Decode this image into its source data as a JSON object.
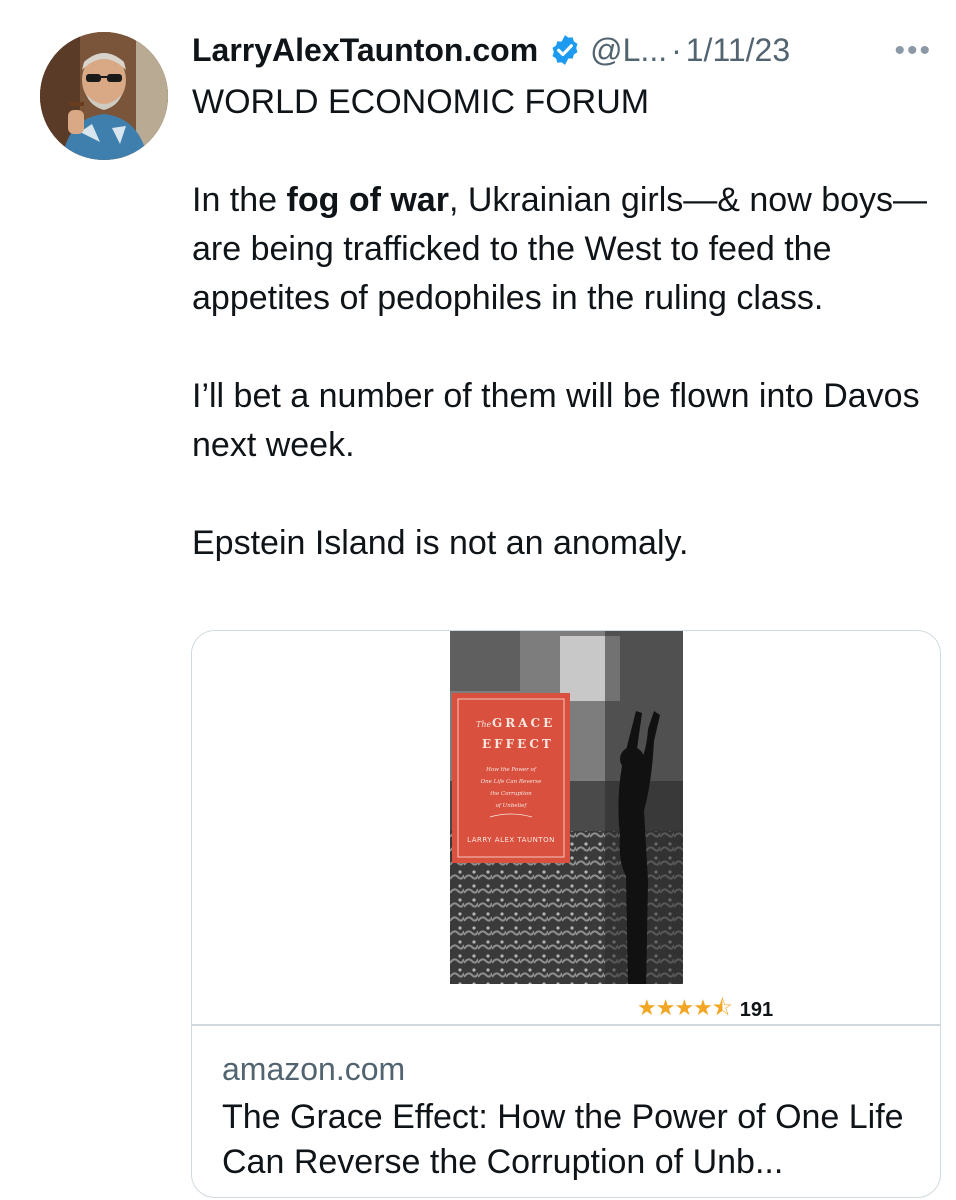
{
  "author": {
    "name": "LarryAlexTaunton.com",
    "handle": "@L...",
    "separator": "·",
    "date": "1/11/23",
    "verified_icon": "verified-badge-icon",
    "more_label": "•••"
  },
  "tweet": {
    "lines": [
      "WORLD ECONOMIC FORUM"
    ],
    "paragraph2_prefix": "In the ",
    "paragraph2_bold": "fog of war",
    "paragraph2_suffix": ", Ukrainian girls—& now boys—are being trafficked to the West to feed the appetites of pedophiles in the ruling class.",
    "paragraph3": "I’ll bet a number of them will be flown into Davos next week.",
    "paragraph4": "Epstein Island is not an anomaly."
  },
  "link_card": {
    "book_cover_text": {
      "title_prefix": "The",
      "title_line1": "GRACE",
      "title_line2": "EFFECT",
      "subtitle": "How the Power of One Life Can Reverse the Corruption of Unbelief",
      "author": "LARRY ALEX TAUNTON"
    },
    "rating_stars": 4.5,
    "rating_count": "191",
    "domain": "amazon.com",
    "title": "The Grace Effect: How the Power of One Life Can Reverse the Corruption of Unb..."
  },
  "colors": {
    "verified": "#1d9bf0",
    "muted": "#536471",
    "cover_red": "#d9503f"
  }
}
